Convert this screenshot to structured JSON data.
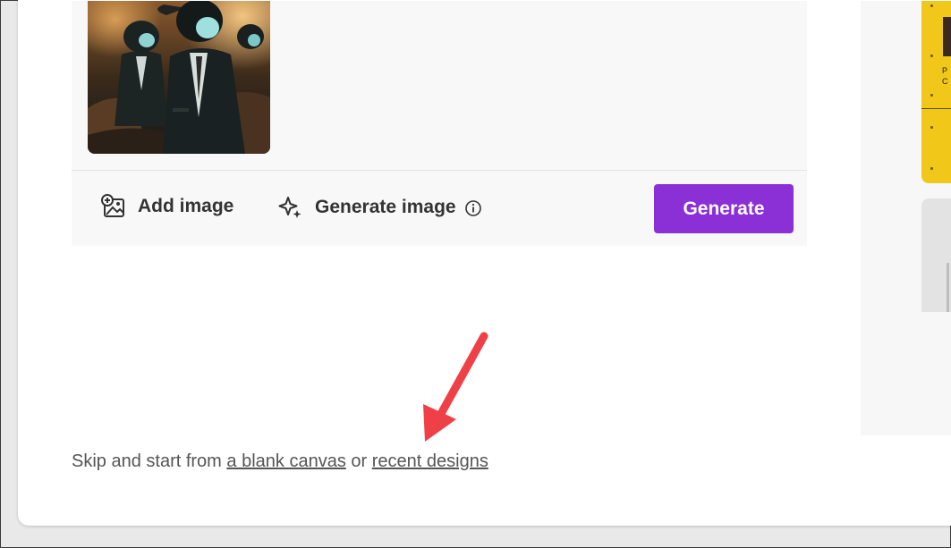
{
  "toolbar": {
    "add_image_label": "Add image",
    "generate_image_label": "Generate image",
    "generate_button_label": "Generate"
  },
  "skip": {
    "prefix": "Skip and start from",
    "blank_canvas_link": "a blank canvas",
    "or_text": "or",
    "recent_designs_link": "recent designs"
  },
  "side_card": {
    "text_line_1": "P",
    "text_line_2": "C"
  },
  "colors": {
    "accent": "#8b2fd6",
    "annotation_arrow": "#ef4048",
    "yellow_card": "#f1c81a"
  },
  "icons": {
    "add_image": "image-plus-icon",
    "generate_image": "sparkle-icon",
    "info": "info-icon"
  }
}
